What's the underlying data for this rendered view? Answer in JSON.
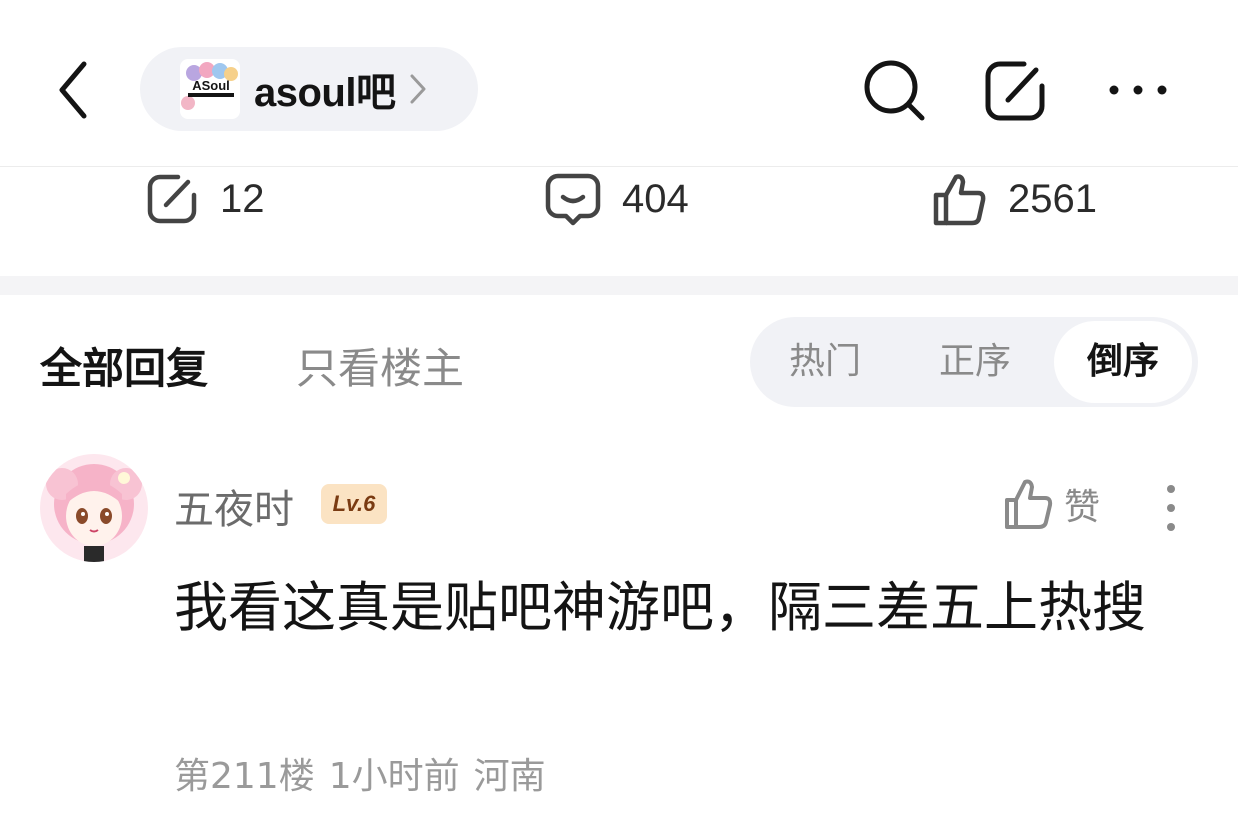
{
  "header": {
    "back_icon": "chevron-left-icon",
    "forum_name": "asoul吧",
    "forum_logo_text": "ASoul",
    "search_icon": "search-icon",
    "edit_icon": "edit-icon",
    "more_icon": "more-horizontal-icon"
  },
  "stats": {
    "shares": "12",
    "comments": "404",
    "likes": "2561"
  },
  "tabs": {
    "all": "全部回复",
    "host_only": "只看楼主"
  },
  "sort": {
    "hot": "热门",
    "asc": "正序",
    "desc": "倒序",
    "selected": "倒序"
  },
  "comment": {
    "username": "五夜时",
    "level": "Lv.6",
    "like_label": "赞",
    "text": "我看这真是贴吧神游吧，隔三差五上热搜",
    "floor": "第211楼",
    "time": "1小时前",
    "location": "河南"
  },
  "colors": {
    "accent_level_bg": "#fbe3c3",
    "accent_level_text": "#7a3b12",
    "pill_bg": "#f1f2f6"
  }
}
